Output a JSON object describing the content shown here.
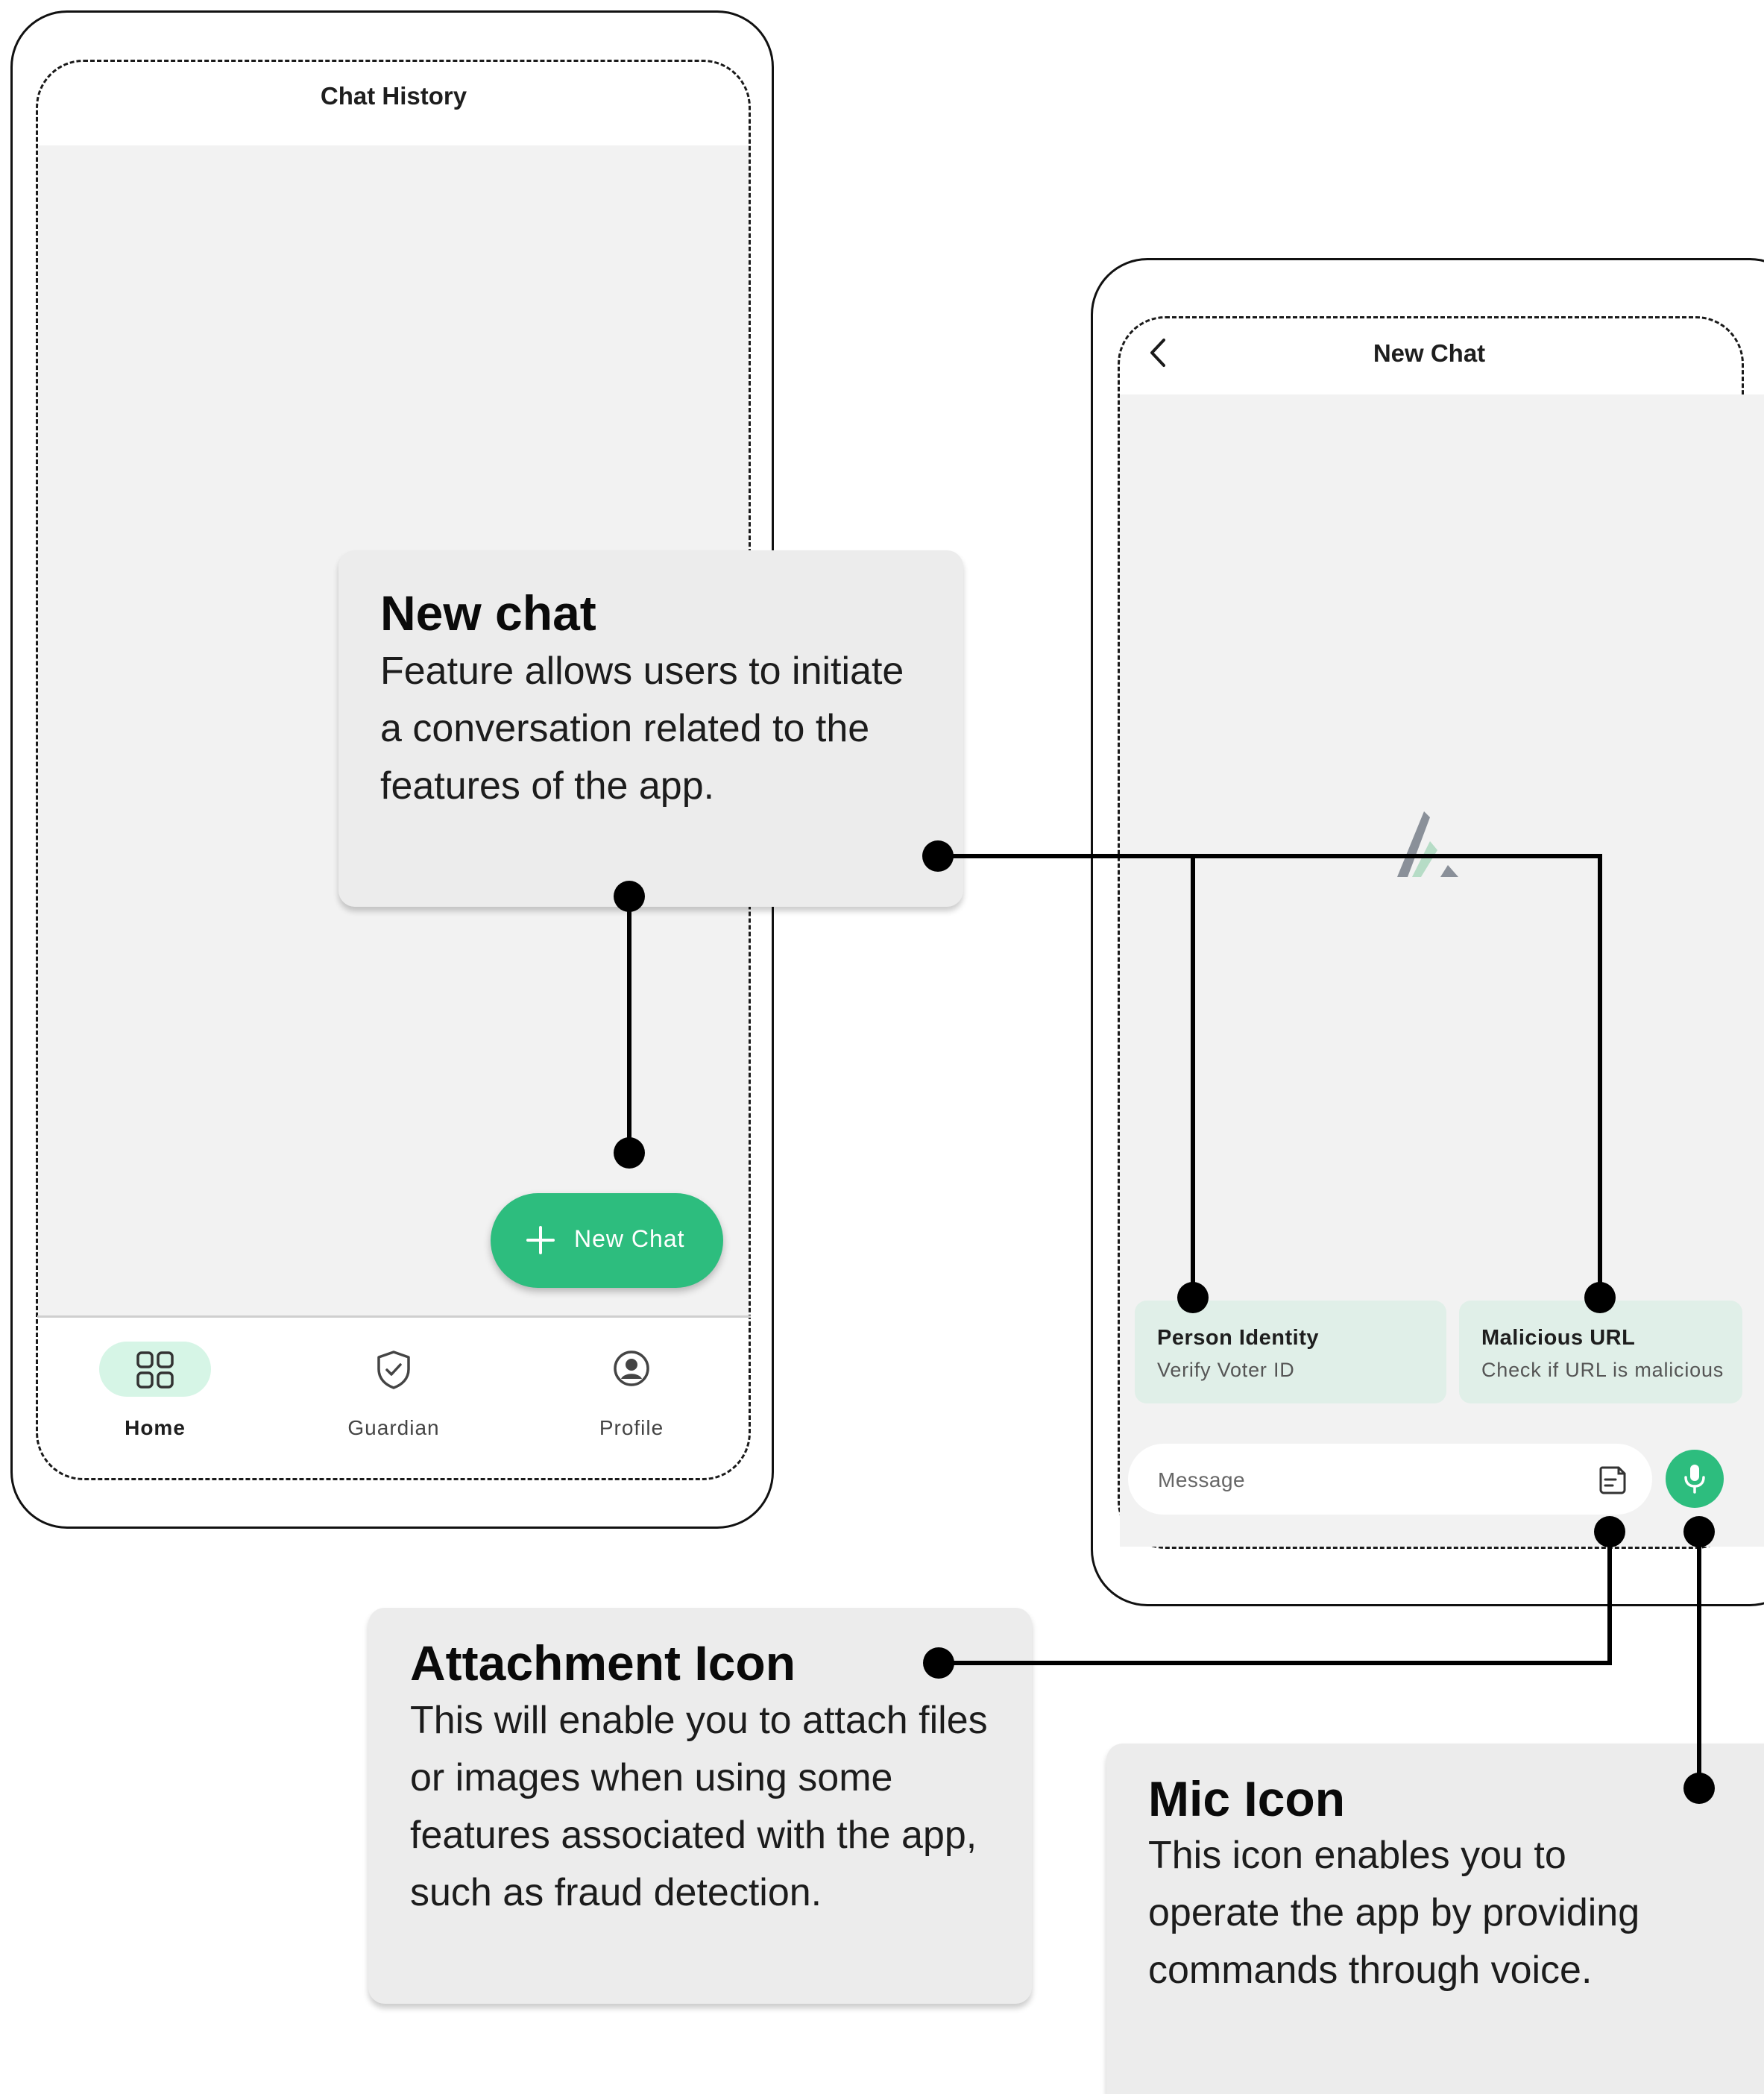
{
  "left_screen": {
    "title": "Chat History",
    "fab_label": "New Chat",
    "nav": [
      {
        "label": "Home",
        "icon": "grid-icon",
        "active": true
      },
      {
        "label": "Guardian",
        "icon": "shield-check-icon",
        "active": false
      },
      {
        "label": "Profile",
        "icon": "user-circle-icon",
        "active": false
      }
    ]
  },
  "right_screen": {
    "title": "New Chat",
    "suggestions": [
      {
        "title": "Person Identity",
        "subtitle": "Verify Voter ID"
      },
      {
        "title": "Malicious URL",
        "subtitle": "Check if URL is malicious"
      }
    ],
    "message_placeholder": "Message"
  },
  "callouts": {
    "new_chat": {
      "heading": "New chat",
      "body": "Feature allows users to initiate a conversation related to the features of the app."
    },
    "attachment": {
      "heading": "Attachment Icon",
      "body": "This will enable you to attach files or images when using some features associated with the app, such as fraud detection."
    },
    "mic": {
      "heading": "Mic Icon",
      "body": "This icon enables you to operate the app by providing commands through voice."
    }
  },
  "colors": {
    "accent": "#2dbd7e",
    "chip": "#e0efe8",
    "screen_bg": "#f2f2f2",
    "callout_bg": "#ececec"
  }
}
